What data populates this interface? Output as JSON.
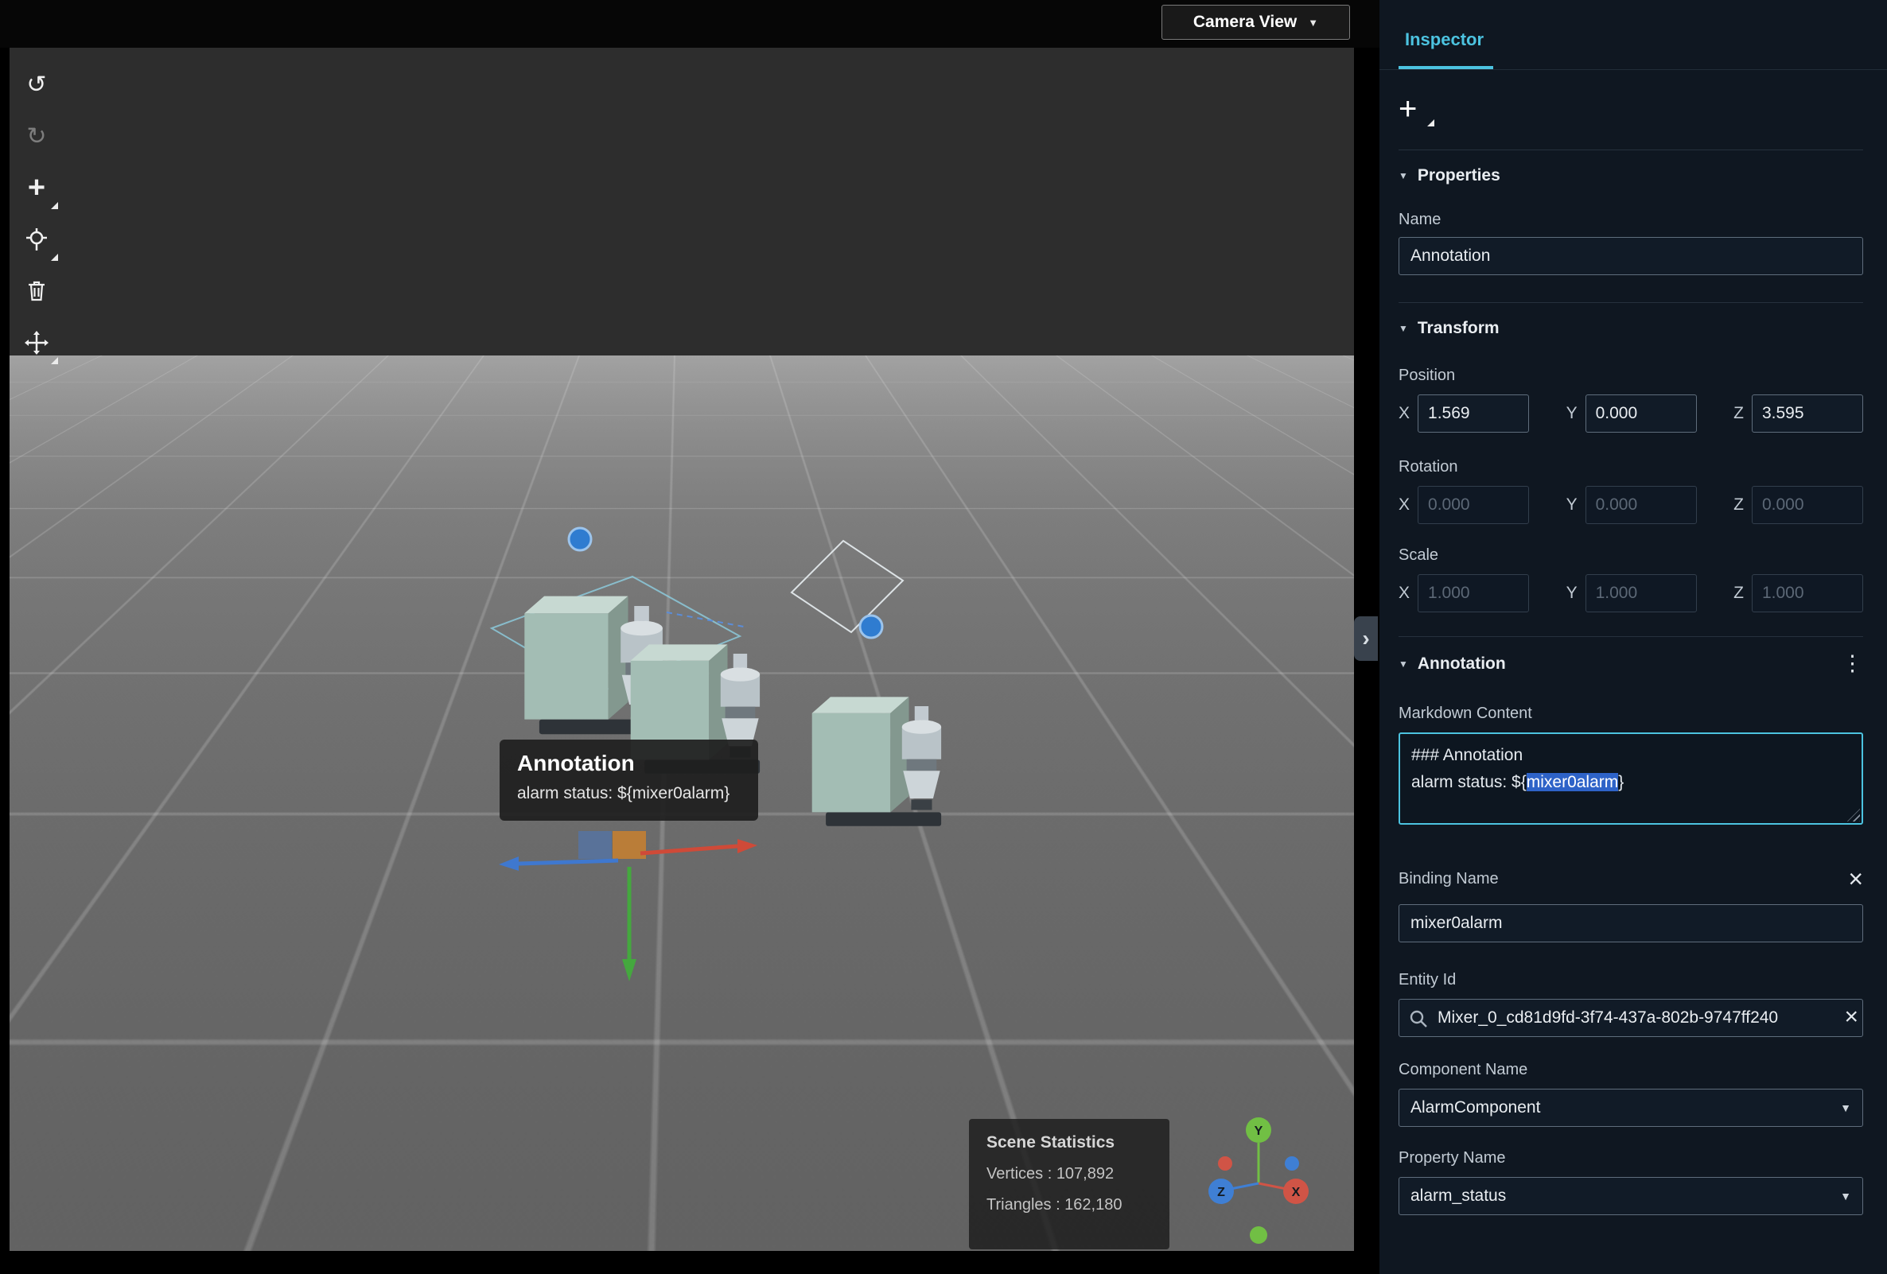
{
  "colors": {
    "accent": "#4cc3e0",
    "selection": "#2e63c8",
    "panel_bg": "#0f1721"
  },
  "icons": {
    "caret_down": "▼",
    "kebab": "⋮",
    "close": "×",
    "collapse": "›",
    "tri": "▼"
  },
  "topbar": {
    "camera_view_label": "Camera View"
  },
  "toolbar": {
    "buttons": [
      "undo",
      "redo",
      "add-object",
      "anchor-tool",
      "delete",
      "move-tool"
    ]
  },
  "viewport": {
    "annotation_tooltip": {
      "title": "Annotation",
      "body": "alarm status: ${mixer0alarm}"
    },
    "scene_statistics": {
      "title": "Scene Statistics",
      "vertices": "Vertices : 107,892",
      "triangles": "Triangles : 162,180"
    },
    "axis_triad": {
      "x": "X",
      "y": "Y",
      "z": "Z"
    }
  },
  "inspector": {
    "tab_label": "Inspector",
    "add_button_label": "+",
    "sections": {
      "properties": {
        "title": "Properties",
        "name_label": "Name",
        "name_value": "Annotation"
      },
      "transform": {
        "title": "Transform",
        "axis_labels": {
          "x": "X",
          "y": "Y",
          "z": "Z"
        },
        "position_label": "Position",
        "position": {
          "x": "1.569",
          "y": "0.000",
          "z": "3.595"
        },
        "rotation_label": "Rotation",
        "rotation": {
          "x": "0.000",
          "y": "0.000",
          "z": "0.000"
        },
        "scale_label": "Scale",
        "scale": {
          "x": "1.000",
          "y": "1.000",
          "z": "1.000"
        }
      },
      "annotation": {
        "title": "Annotation",
        "markdown_label": "Markdown Content",
        "markdown_line1": "### Annotation",
        "markdown_line2_prefix": "alarm status: ${",
        "markdown_line2_selected": "mixer0alarm",
        "markdown_line2_suffix": "}",
        "binding_name_label": "Binding Name",
        "binding_name_value": "mixer0alarm",
        "entity_id_label": "Entity Id",
        "entity_id_value": "Mixer_0_cd81d9fd-3f74-437a-802b-9747ff240",
        "component_name_label": "Component Name",
        "component_name_value": "AlarmComponent",
        "property_name_label": "Property Name",
        "property_name_value": "alarm_status"
      }
    }
  }
}
